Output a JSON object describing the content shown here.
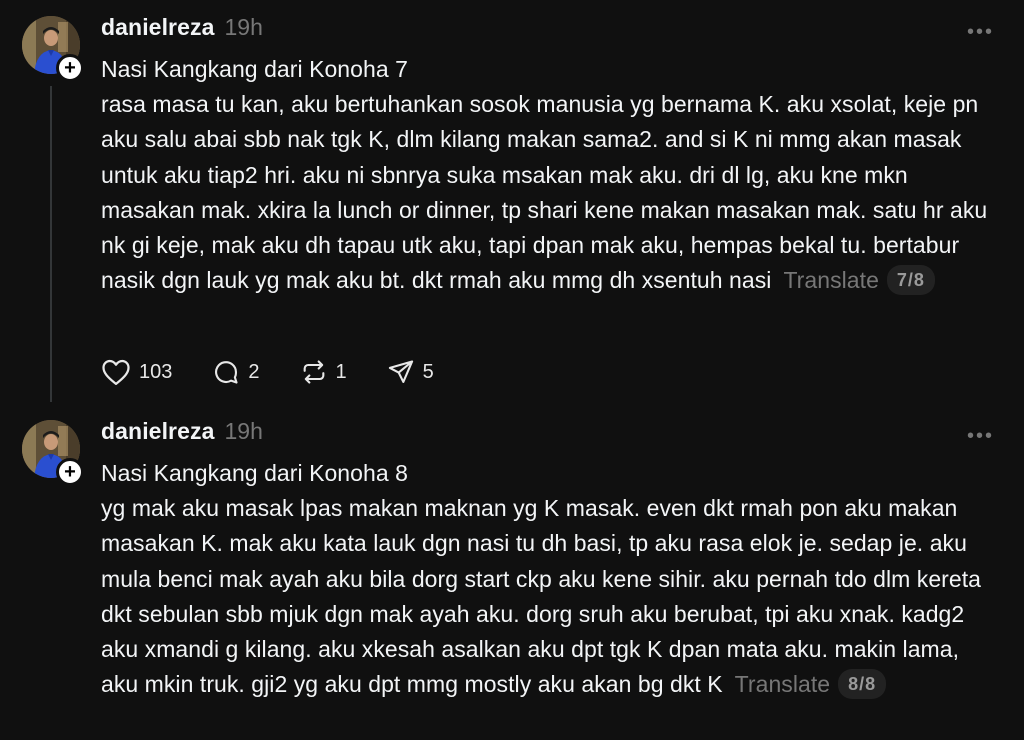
{
  "colors": {
    "background": "#101010",
    "text": "#f3f5f7",
    "muted": "#777777",
    "thread_line": "#333638",
    "pager_bg": "#222222"
  },
  "posts": [
    {
      "username": "danielreza",
      "timestamp": "19h",
      "more_icon": "more-horizontal-icon",
      "text": "Nasi Kangkang dari Konoha 7\nrasa masa tu kan, aku bertuhankan sosok manusia yg bernama K. aku xsolat, keje pn aku salu abai sbb nak tgk K, dlm kilang makan sama2. and si K ni mmg akan masak untuk aku tiap2 hri. aku ni sbnrya suka msakan mak aku. dri dl lg, aku kne mkn masakan mak. xkira la lunch or dinner, tp shari kene makan masakan mak. satu hr aku nk gi keje, mak aku dh tapau utk aku, tapi dpan mak aku, hempas bekal tu. bertabur nasik dgn lauk yg mak aku bt. dkt rmah aku mmg dh xsentuh nasi",
      "translate_label": "Translate",
      "pager": "7/8",
      "actions": {
        "likes": "103",
        "replies": "2",
        "reposts": "1",
        "shares": "5"
      }
    },
    {
      "username": "danielreza",
      "timestamp": "19h",
      "more_icon": "more-horizontal-icon",
      "text": "Nasi Kangkang dari Konoha 8\nyg mak aku masak lpas makan maknan yg K masak. even dkt rmah pon aku makan masakan K. mak aku kata lauk dgn nasi tu dh basi, tp aku rasa elok je. sedap je. aku mula benci mak ayah aku bila dorg start ckp aku kene sihir. aku pernah tdo dlm kereta dkt sebulan sbb mjuk dgn mak ayah aku. dorg sruh aku berubat, tpi aku xnak. kadg2 aku xmandi g kilang. aku xkesah asalkan aku dpt tgk K dpan mata aku. makin lama, aku mkin truk. gji2 yg aku dpt mmg mostly aku akan bg dkt K",
      "translate_label": "Translate",
      "pager": "8/8"
    }
  ]
}
